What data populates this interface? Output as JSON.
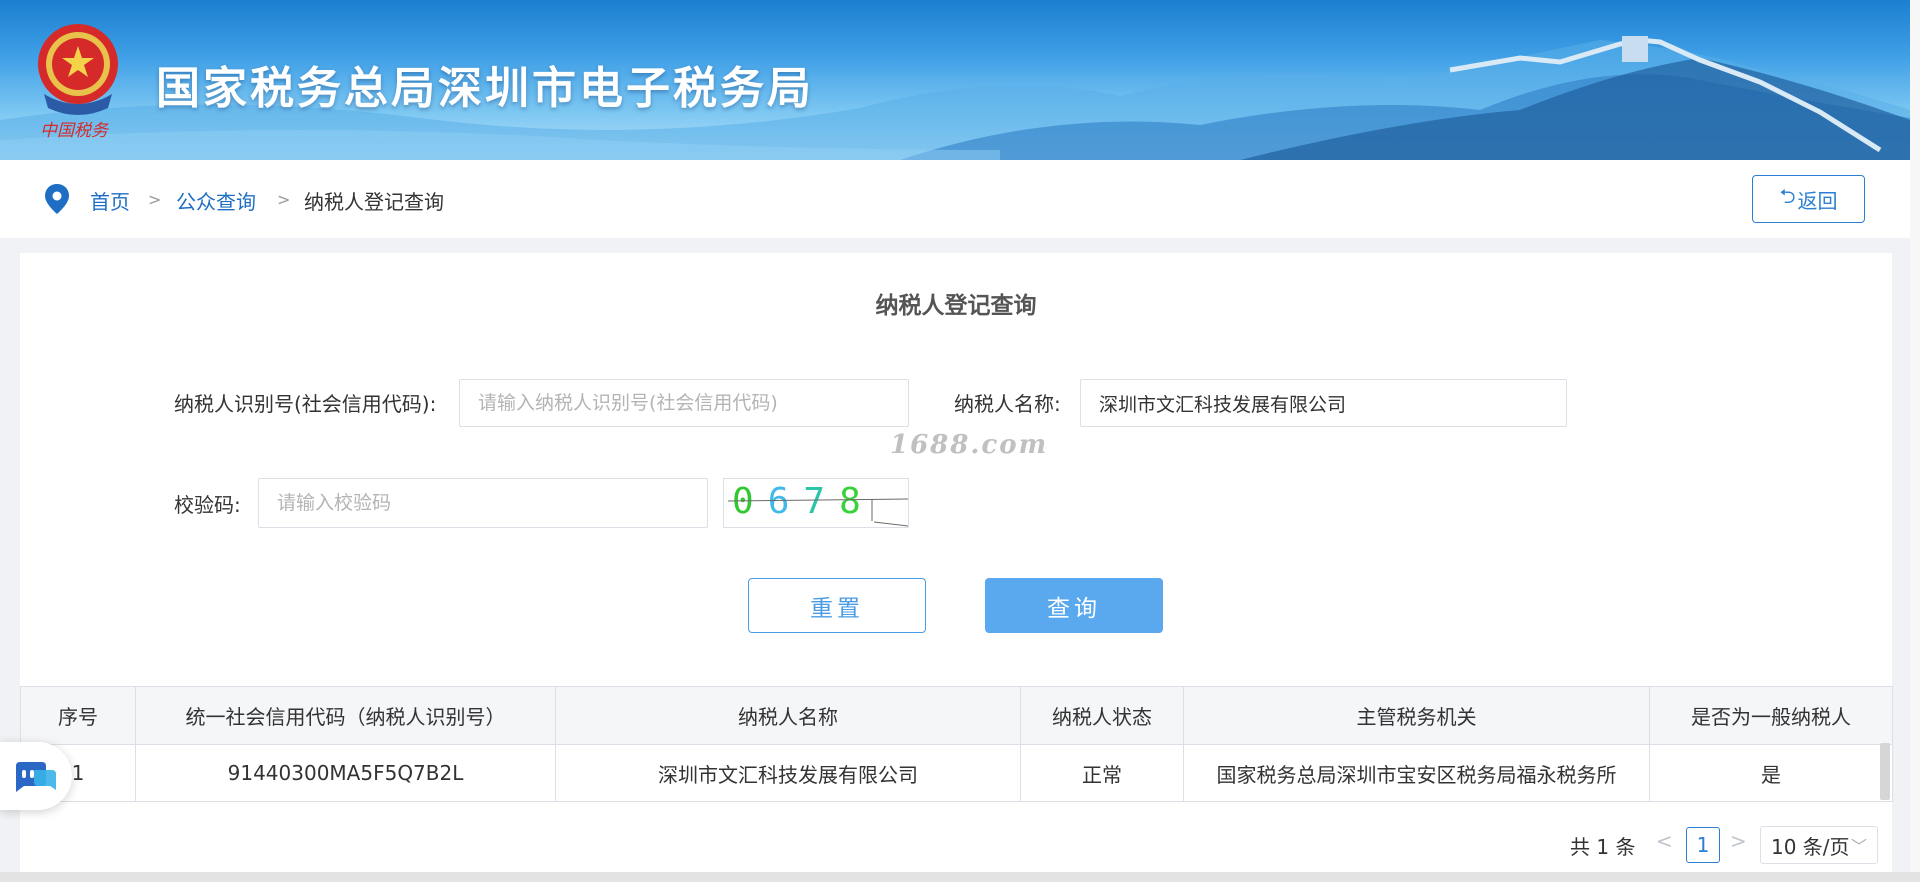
{
  "banner": {
    "title": "国家税务总局深圳市电子税务局"
  },
  "breadcrumb": {
    "items": [
      {
        "label": "首页"
      },
      {
        "label": "公众查询"
      },
      {
        "label": "纳税人登记查询"
      }
    ],
    "separator": ">",
    "back_label": "返回"
  },
  "form": {
    "title": "纳税人登记查询",
    "tax_id_label": "纳税人识别号(社会信用代码):",
    "tax_id_placeholder": "请输入纳税人识别号(社会信用代码)",
    "tax_id_value": "",
    "name_label": "纳税人名称:",
    "name_value": "深圳市文汇科技发展有限公司",
    "captcha_label": "校验码:",
    "captcha_placeholder": "请输入校验码",
    "captcha_code": [
      "0",
      "6",
      "7",
      "8"
    ],
    "reset_label": "重置",
    "query_label": "查询"
  },
  "watermark": "1688.com",
  "table": {
    "columns": [
      "序号",
      "统一社会信用代码（纳税人识别号）",
      "纳税人名称",
      "纳税人状态",
      "主管税务机关",
      "是否为一般纳税人"
    ],
    "rows": [
      [
        "1",
        "91440300MA5F5Q7B2L",
        "深圳市文汇科技发展有限公司",
        "正常",
        "国家税务总局深圳市宝安区税务局福永税务所",
        "是"
      ]
    ]
  },
  "pagination": {
    "total": "共 1 条",
    "prev": "<",
    "next": ">",
    "current_page": "1",
    "page_size": "10 条/页"
  },
  "colors": {
    "primary": "#2b7fd3",
    "query_button": "#5aa9ee",
    "banner": "#2a8fe0"
  }
}
